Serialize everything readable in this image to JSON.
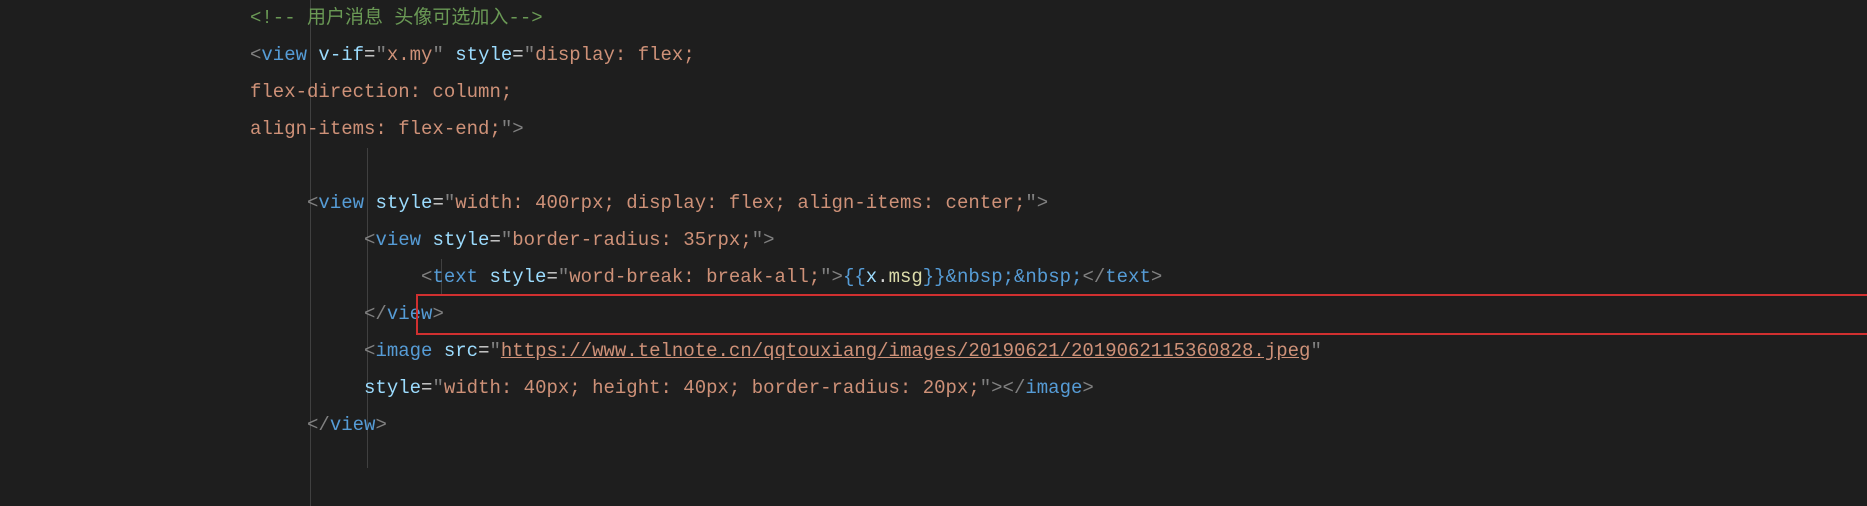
{
  "lines": {
    "l1": {
      "comment_open": "<!--",
      "comment_text": " 用户消息 头像可选加入",
      "comment_close": "-->"
    },
    "l2": {
      "tag": "view",
      "attr1_name": "v-if",
      "attr1_val": "x.my",
      "attr2_name": "style",
      "attr2_val": "display: flex;"
    },
    "l3": {
      "text": "flex-direction: column;"
    },
    "l4": {
      "text": "align-items: flex-end;",
      "close": ">"
    },
    "l6": {
      "tag": "view",
      "attr1_name": "style",
      "attr1_val": "width: 400rpx; display: flex; align-items: center;",
      "close": ">"
    },
    "l7": {
      "tag": "view",
      "attr1_name": "style",
      "attr1_val": "border-radius: 35rpx;",
      "close": ">"
    },
    "l8": {
      "tag": "text",
      "attr1_name": "style",
      "attr1_val": "word-break: break-all;",
      "mustache_open": "{{",
      "mustache_obj": "x",
      "mustache_dot": ".",
      "mustache_prop": "msg",
      "mustache_close": "}}",
      "entity1": "&nbsp;",
      "entity2": "&nbsp;",
      "close_tag": "text"
    },
    "l9": {
      "close_tag": "view"
    },
    "l10": {
      "tag": "image",
      "attr1_name": "src",
      "attr1_val": "https://www.telnote.cn/qqtouxiang/images/20190621/2019062115360828.jpeg"
    },
    "l11": {
      "attr1_name": "style",
      "attr1_val": "width: 40px; height: 40px; border-radius: 20px;",
      "close_tag": "image"
    },
    "l12": {
      "close_tag": "view"
    }
  }
}
